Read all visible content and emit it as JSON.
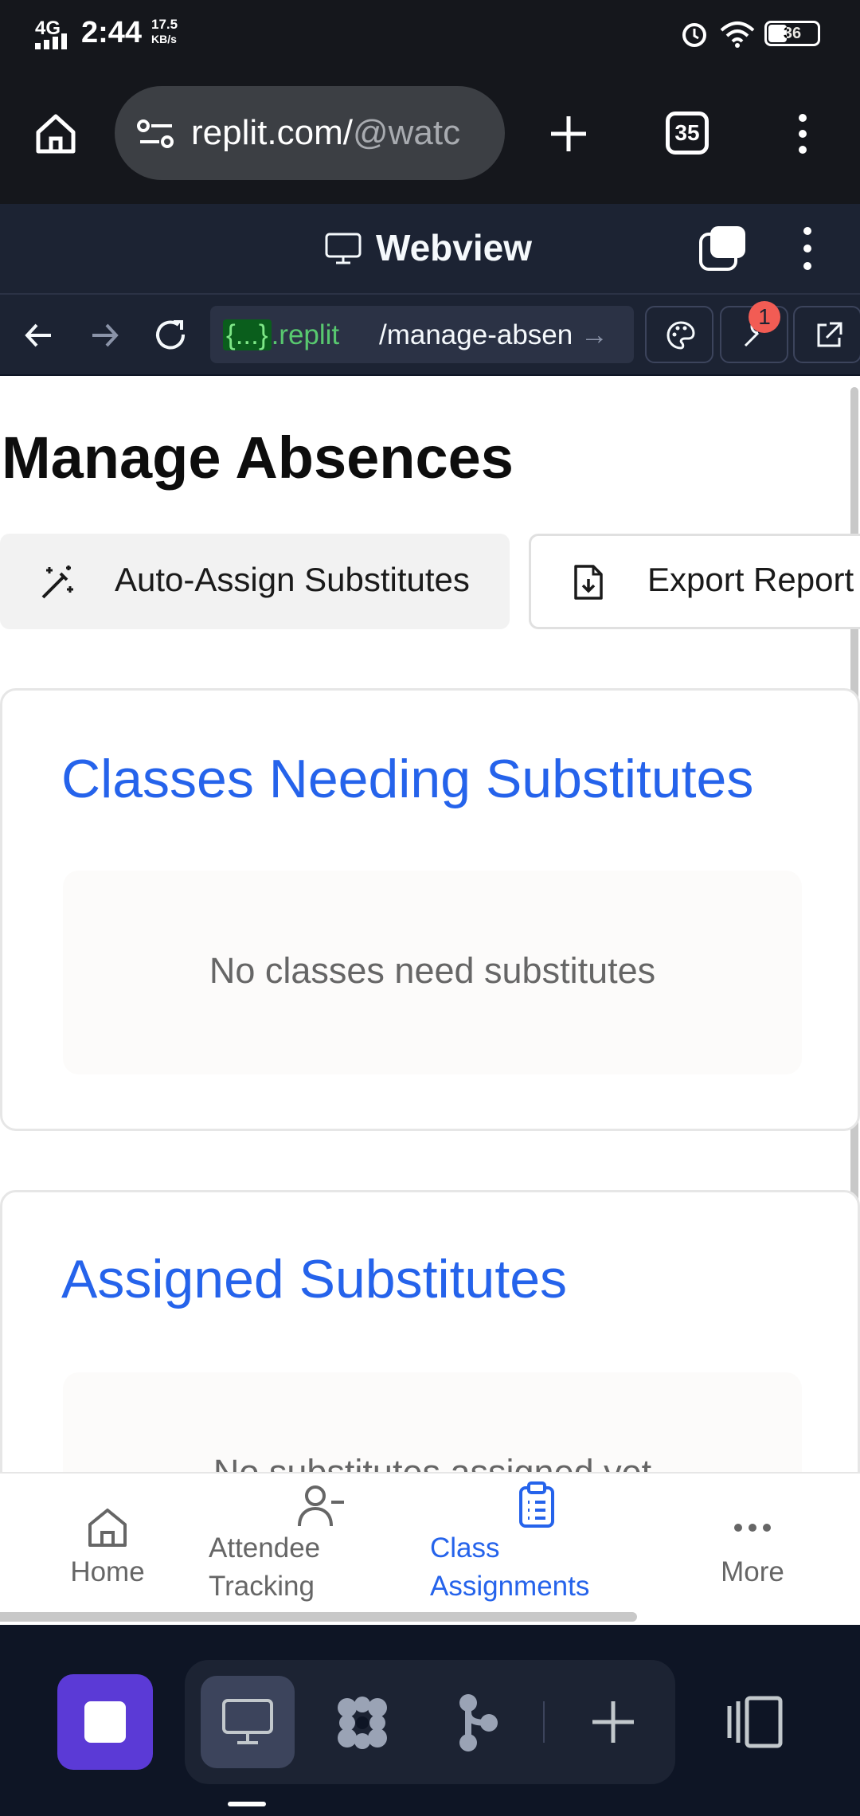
{
  "status_bar": {
    "network": "4G",
    "time": "2:44",
    "speed_value": "17.5",
    "speed_unit": "KB/s",
    "battery": "36"
  },
  "browser": {
    "url_domain": "replit.com/",
    "url_path": "@watc",
    "tab_count": "35"
  },
  "replit_header": {
    "title": "Webview"
  },
  "webview_toolbar": {
    "url_prefix": "{...}",
    "url_host": ".replit",
    "url_path": "/manage-absen",
    "badge_count": "1"
  },
  "page": {
    "title": "Manage Absences",
    "auto_assign_label": "Auto-Assign Substitutes",
    "export_label": "Export Report",
    "sections": [
      {
        "title": "Classes Needing Substitutes",
        "empty_text": "No classes need substitutes"
      },
      {
        "title": "Assigned Substitutes",
        "empty_text": "No substitutes assigned yet"
      }
    ]
  },
  "bottom_nav": {
    "items": [
      {
        "label": "Home",
        "icon": "home-icon"
      },
      {
        "label": "Attendee Tracking",
        "icon": "user-minus-icon"
      },
      {
        "label": "Class Assignments",
        "icon": "clipboard-list-icon",
        "active": true
      },
      {
        "label": "More",
        "icon": "more-horizontal-icon"
      }
    ],
    "active_color": "#2563eb",
    "inactive_color": "#666666"
  },
  "colors": {
    "replit_bg": "#1c2333",
    "accent_blue": "#2563eb",
    "stop_button": "#5b3ad6"
  }
}
